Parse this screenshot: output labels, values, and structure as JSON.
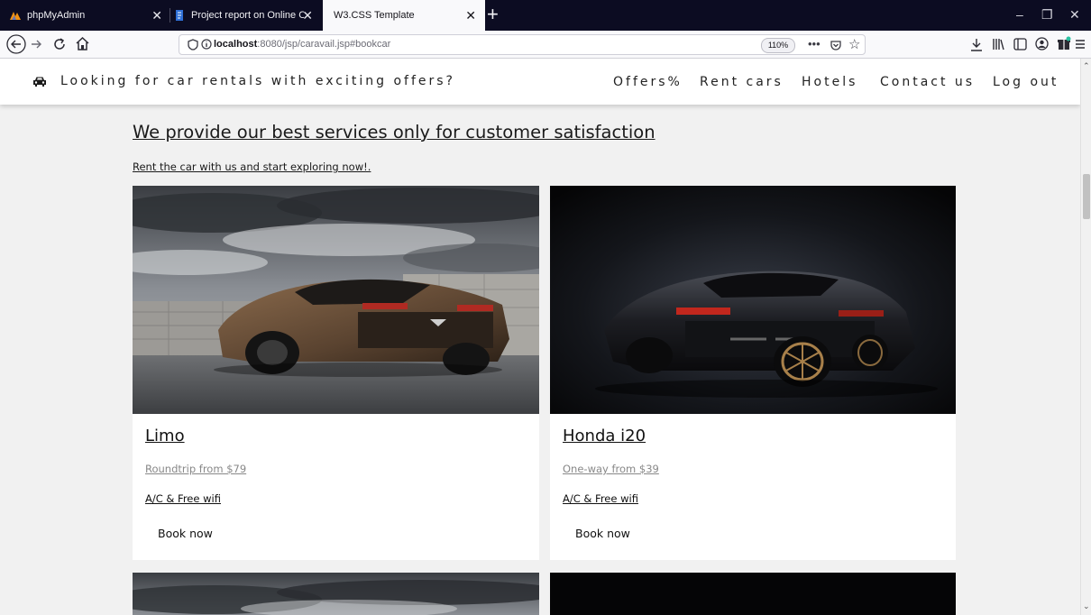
{
  "browser": {
    "tabs": [
      {
        "title": "phpMyAdmin",
        "icon": "phpmyadmin-icon"
      },
      {
        "title": "Project report on Online Car Re",
        "icon": "document-icon"
      },
      {
        "title": "W3.CSS Template",
        "icon": "none"
      }
    ],
    "url_host": "localhost",
    "url_rest": ":8080/jsp/caravail.jsp#bookcar",
    "zoom": "110%"
  },
  "site": {
    "tagline": "Looking for car rentals with exciting offers?",
    "nav": [
      "Offers%",
      "Rent cars",
      "Hotels",
      "Contact us",
      "Log out"
    ]
  },
  "content": {
    "headline": "We provide our best services only for customer satisfaction",
    "subline": "Rent the car with us and start exploring now!.",
    "cards": [
      {
        "name": "Limo",
        "price": "Roundtrip from $79",
        "features": "A/C & Free wifi",
        "button": "Book now"
      },
      {
        "name": "Honda i20",
        "price": "One-way from $39",
        "features": "A/C & Free wifi",
        "button": "Book now"
      }
    ]
  },
  "colors": {
    "tabbar": "#0c0c22",
    "page_bg": "#f1f1f1",
    "card_bg": "#ffffff",
    "price_text": "#888888"
  }
}
